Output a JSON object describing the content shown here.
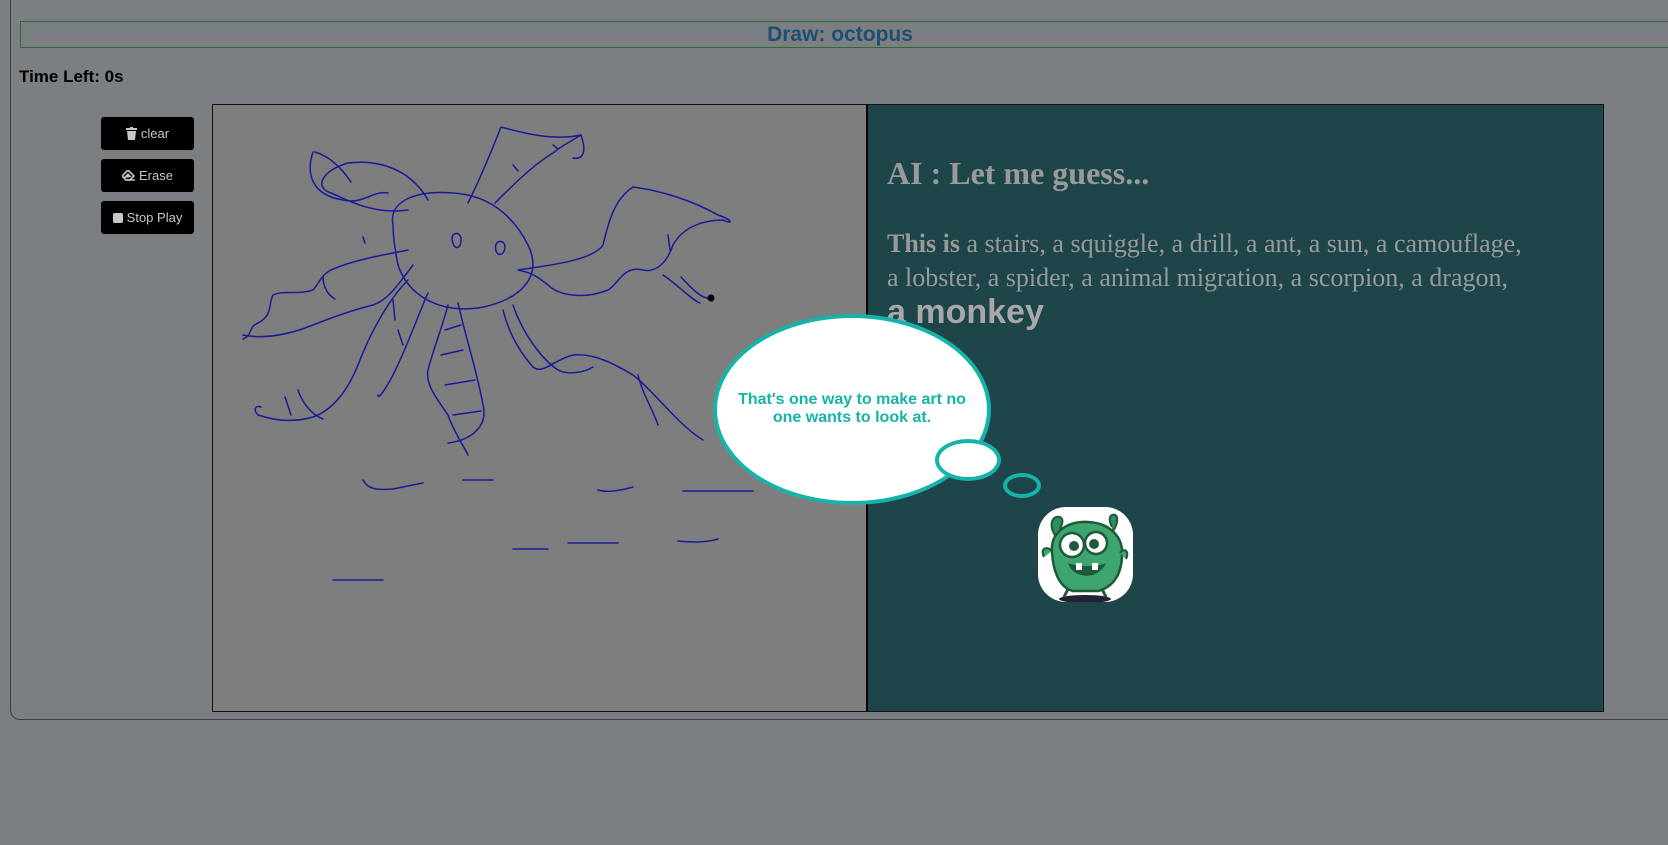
{
  "header": {
    "title": "Draw: octopus"
  },
  "timer": {
    "label": "Time Left: 0s"
  },
  "toolbar": {
    "clear_label": "clear",
    "erase_label": "Erase",
    "stop_label": "Stop Play"
  },
  "ai_panel": {
    "heading": "AI : Let me guess...",
    "guess_prefix": "This is",
    "guesses_text": " a stairs, a squiggle, a drill, a ant, a sun, a camouflage, a lobster, a spider, a animal migration, a scorpion, a dragon,",
    "final_guess": "a monkey"
  },
  "speech_bubble": {
    "text": "That's one way to make art no one wants to look at."
  },
  "colors": {
    "page_bg": "#7b7f82",
    "title_text": "#1e4f73",
    "panel_bg": "#1e4549",
    "bubble_accent": "#15b3aa",
    "stroke": "#1a1a9a"
  },
  "icons": {
    "clear": "trash-icon",
    "erase": "eraser-icon",
    "stop": "stop-icon",
    "avatar": "green-monster-icon"
  }
}
